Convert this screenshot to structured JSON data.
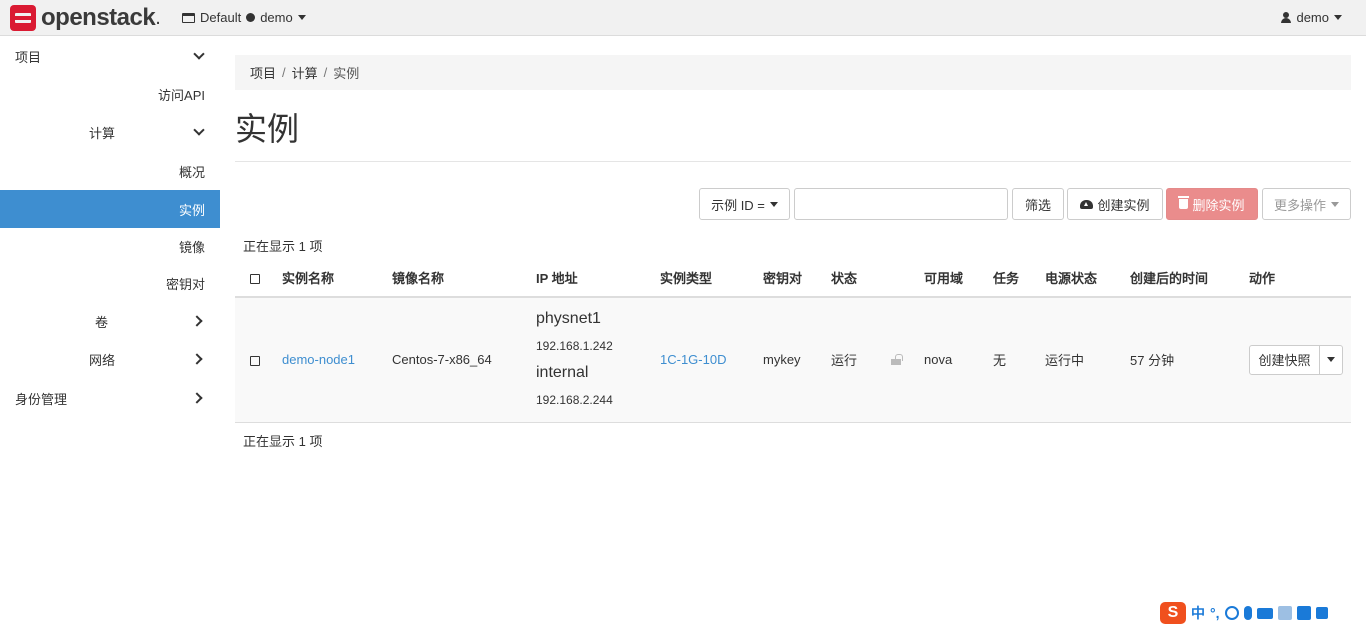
{
  "navbar": {
    "brand": "openstack",
    "brand_dot": ".",
    "domain": "Default",
    "project": "demo",
    "user": "demo"
  },
  "sidebar": {
    "project": "项目",
    "api_access": "访问API",
    "compute": "计算",
    "overview": "概况",
    "instances": "实例",
    "images": "镜像",
    "key_pairs": "密钥对",
    "volumes": "卷",
    "network": "网络",
    "identity": "身份管理"
  },
  "breadcrumb": [
    "项目",
    "计算",
    "实例"
  ],
  "page_title": "实例",
  "toolbar": {
    "filter_field": "示例 ID =",
    "filter_value": "",
    "filter_button": "筛选",
    "create_button": "创建实例",
    "delete_button": "删除实例",
    "more_button": "更多操作"
  },
  "table": {
    "count_text": "正在显示 1 项",
    "headers": [
      "实例名称",
      "镜像名称",
      "IP 地址",
      "实例类型",
      "密钥对",
      "状态",
      "可用域",
      "任务",
      "电源状态",
      "创建后的时间",
      "动作"
    ],
    "rows": [
      {
        "name": "demo-node1",
        "image": "Centos-7-x86_64",
        "net1": "physnet1",
        "ip1": "192.168.1.242",
        "net2": "internal",
        "ip2": "192.168.2.244",
        "flavor": "1C-1G-10D",
        "keypair": "mykey",
        "status": "运行",
        "az": "nova",
        "task": "无",
        "power": "运行中",
        "age": "57 分钟",
        "action": "创建快照"
      }
    ]
  },
  "ime": {
    "logo": "S",
    "lang": "中",
    "punct": "°,"
  },
  "colors": {
    "accent": "#3e8ed0",
    "danger": "#ea8c8c",
    "brand": "#da1a32"
  }
}
